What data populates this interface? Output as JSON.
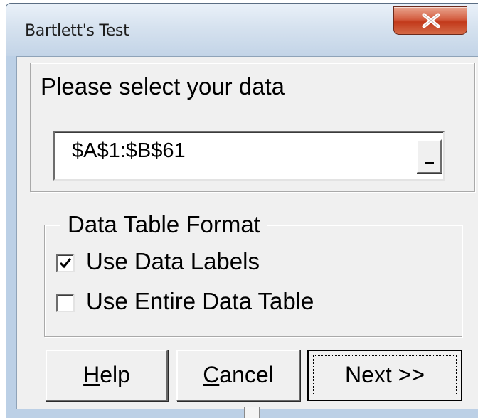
{
  "window": {
    "title": "Bartlett's Test",
    "close_icon": "close-x-icon"
  },
  "data_selection": {
    "heading": "Please select your data",
    "range_value": "$A$1:$B$61",
    "range_button_icon": "range-select-icon"
  },
  "format": {
    "legend": "Data Table Format",
    "options": [
      {
        "label": "Use Data Labels",
        "checked": true
      },
      {
        "label": "Use Entire Data Table",
        "checked": false
      }
    ]
  },
  "buttons": {
    "help": {
      "mnemonic": "H",
      "rest": "elp"
    },
    "cancel": {
      "mnemonic": "C",
      "rest": "ancel"
    },
    "next": "Next >>"
  },
  "colors": {
    "close_button": "#c2391a",
    "client_background": "#f0f0f0",
    "frame": "#bcd0e6"
  }
}
